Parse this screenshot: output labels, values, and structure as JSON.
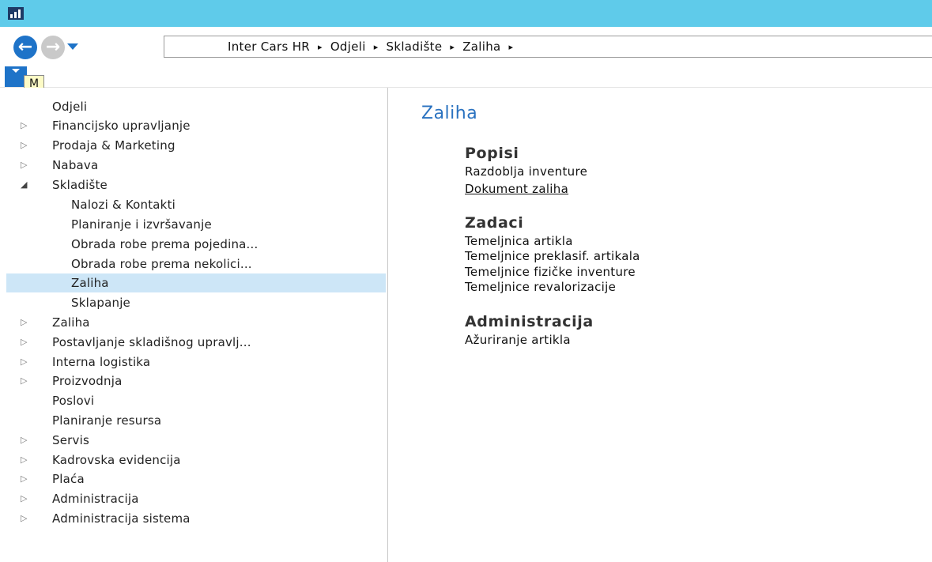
{
  "app": {
    "icon": "chart-logo-icon",
    "accent": "#1e73c8",
    "titlebar_color": "#5fcbea"
  },
  "navigation": {
    "back_icon": "arrow-left-icon",
    "forward_icon": "arrow-right-icon",
    "breadcrumbs": [
      "Inter Cars HR",
      "Odjeli",
      "Skladište",
      "Zaliha"
    ],
    "separator": "▸"
  },
  "keytip": "M",
  "sidebar": {
    "items": [
      {
        "label": "Odjeli",
        "expander": ""
      },
      {
        "label": "Financijsko upravljanje",
        "expander": "▷"
      },
      {
        "label": "Prodaja & Marketing",
        "expander": "▷"
      },
      {
        "label": "Nabava",
        "expander": "▷"
      },
      {
        "label": "Skladište",
        "expander": "◢"
      },
      {
        "label": "Nalozi & Kontakti",
        "expander": ""
      },
      {
        "label": "Planiranje i izvršavanje",
        "expander": ""
      },
      {
        "label": "Obrada robe prema pojedina...",
        "expander": ""
      },
      {
        "label": "Obrada robe prema nekolici...",
        "expander": ""
      },
      {
        "label": "Zaliha",
        "expander": ""
      },
      {
        "label": "Sklapanje",
        "expander": ""
      },
      {
        "label": "Zaliha",
        "expander": "▷"
      },
      {
        "label": "Postavljanje skladišnog upravlj...",
        "expander": "▷"
      },
      {
        "label": "Interna logistika",
        "expander": "▷"
      },
      {
        "label": "Proizvodnja",
        "expander": "▷"
      },
      {
        "label": "Poslovi",
        "expander": ""
      },
      {
        "label": "Planiranje resursa",
        "expander": ""
      },
      {
        "label": "Servis",
        "expander": "▷"
      },
      {
        "label": "Kadrovska evidencija",
        "expander": "▷"
      },
      {
        "label": "Plaća",
        "expander": "▷"
      },
      {
        "label": "Administracija",
        "expander": "▷"
      },
      {
        "label": "Administracija sistema",
        "expander": "▷"
      }
    ]
  },
  "main": {
    "title": "Zaliha",
    "groups": [
      {
        "title": "Popisi",
        "links": [
          "Razdoblja inventure",
          "Dokument zaliha"
        ]
      },
      {
        "title": "Zadaci",
        "links": [
          "Temeljnica artikla",
          "Temeljnice preklasif. artikala",
          "Temeljnice fizičke inventure",
          "Temeljnice revalorizacije"
        ]
      },
      {
        "title": "Administracija",
        "links": [
          "Ažuriranje artikla"
        ]
      }
    ]
  }
}
